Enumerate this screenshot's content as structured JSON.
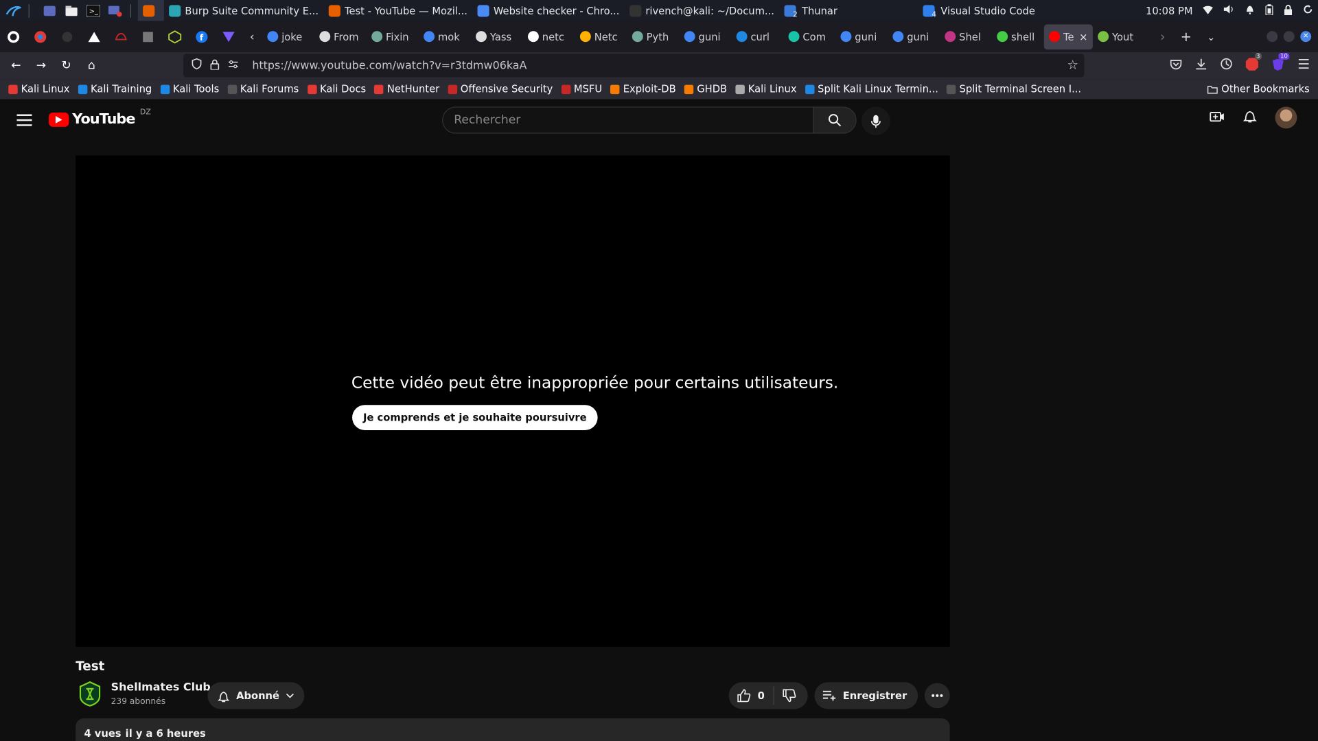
{
  "desktop": {
    "windows": [
      {
        "label": "",
        "active": true,
        "color": "#e66000"
      },
      {
        "label": "Burp Suite Community E...",
        "active": false,
        "color": "#2ca5b5"
      },
      {
        "label": "Test - YouTube — Mozil...",
        "active": false,
        "color": "#e66000"
      },
      {
        "label": "Website checker - Chro...",
        "active": false,
        "color": "#4a8af4"
      },
      {
        "label": "rivench@kali: ~/Docum...",
        "active": false,
        "color": "#333"
      },
      {
        "label": "Thunar",
        "active": false,
        "color": "#3b7ad6",
        "badge": "2"
      },
      {
        "label": "Visual Studio Code",
        "active": false,
        "color": "#2f80ed",
        "badge": "4"
      }
    ],
    "clock": "10:08 PM"
  },
  "tabs": [
    {
      "label": "joke",
      "color": "#4285f4"
    },
    {
      "label": "From",
      "color": "#ddd"
    },
    {
      "label": "Fixin",
      "color": "#74aa9c"
    },
    {
      "label": "mok",
      "color": "#4285f4"
    },
    {
      "label": "Yass",
      "color": "#ddd"
    },
    {
      "label": "netc",
      "color": "#fff"
    },
    {
      "label": "Netc",
      "color": "#ffb300"
    },
    {
      "label": "Pyth",
      "color": "#74aa9c"
    },
    {
      "label": "guni",
      "color": "#4285f4"
    },
    {
      "label": "curl",
      "color": "#1e88e5"
    },
    {
      "label": "Com",
      "color": "#19c3a8"
    },
    {
      "label": "guni",
      "color": "#4285f4"
    },
    {
      "label": "guni",
      "color": "#4285f4"
    },
    {
      "label": "Shel",
      "color": "#c13584"
    },
    {
      "label": "shell",
      "color": "#44cc44"
    },
    {
      "label": "Te",
      "color": "#ff0000",
      "selected": true
    },
    {
      "label": "Yout",
      "color": "#7ac143"
    }
  ],
  "nav": {
    "url": "https://www.youtube.com/watch?v=r3tdmw06kaA",
    "badge1": "3",
    "badge2": "10"
  },
  "bookmarks": [
    {
      "label": "Kali Linux",
      "color": "#e53935"
    },
    {
      "label": "Kali Training",
      "color": "#1e88e5"
    },
    {
      "label": "Kali Tools",
      "color": "#1e88e5"
    },
    {
      "label": "Kali Forums",
      "color": "#555"
    },
    {
      "label": "Kali Docs",
      "color": "#e53935"
    },
    {
      "label": "NetHunter",
      "color": "#e53935"
    },
    {
      "label": "Offensive Security",
      "color": "#c62828"
    },
    {
      "label": "MSFU",
      "color": "#c62828"
    },
    {
      "label": "Exploit-DB",
      "color": "#f57c00"
    },
    {
      "label": "GHDB",
      "color": "#f57c00"
    },
    {
      "label": "Kali Linux",
      "color": "#aaa"
    },
    {
      "label": "Split Kali Linux Termin...",
      "color": "#1e88e5"
    },
    {
      "label": "Split Terminal Screen I...",
      "color": "#555"
    }
  ],
  "other_bookmarks": "Other Bookmarks",
  "youtube": {
    "logo_text": "YouTube",
    "country": "DZ",
    "search_placeholder": "Rechercher",
    "warning": "Cette vidéo peut être inappropriée pour certains utilisateurs.",
    "continue_label": "Je comprends et je souhaite poursuivre",
    "video_title": "Test",
    "channel_name": "Shellmates Club",
    "subscribers": "239 abonnés",
    "subscribe_label": "Abonné",
    "likes": "0",
    "save_label": "Enregistrer",
    "views": "4 vues",
    "age": "il y a 6 heures"
  }
}
